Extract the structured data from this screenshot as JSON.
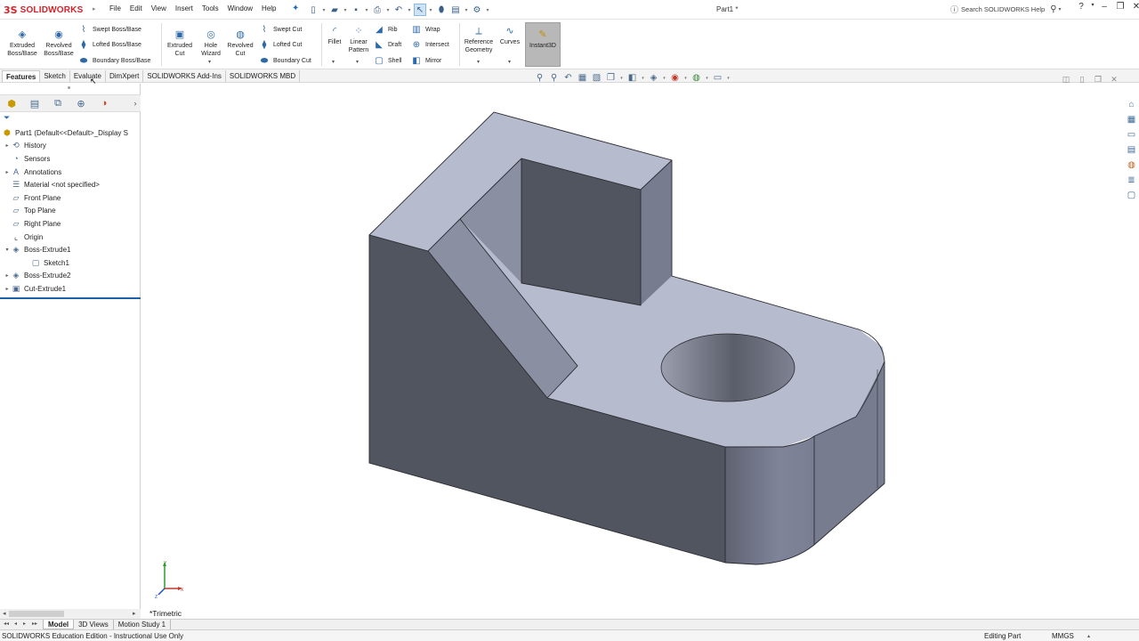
{
  "app": {
    "brand_prefix": "3S",
    "brand_name": "SOLIDWORKS",
    "document_title": "Part1 *",
    "help_search_placeholder": "Search SOLIDWORKS Help"
  },
  "menu": [
    "File",
    "Edit",
    "View",
    "Insert",
    "Tools",
    "Window",
    "Help"
  ],
  "command_manager": {
    "extruded_boss": "Extruded Boss/Base",
    "revolved_boss": "Revolved Boss/Base",
    "swept_boss": "Swept Boss/Base",
    "lofted_boss": "Lofted Boss/Base",
    "boundary_boss": "Boundary Boss/Base",
    "extruded_cut": "Extruded Cut",
    "hole_wizard": "Hole Wizard",
    "revolved_cut": "Revolved Cut",
    "swept_cut": "Swept Cut",
    "lofted_cut": "Lofted Cut",
    "boundary_cut": "Boundary Cut",
    "fillet": "Fillet",
    "linear_pattern": "Linear Pattern",
    "rib": "Rib",
    "draft": "Draft",
    "shell": "Shell",
    "wrap": "Wrap",
    "intersect": "Intersect",
    "mirror": "Mirror",
    "reference_geometry": "Reference Geometry",
    "curves": "Curves",
    "instant3d": "Instant3D"
  },
  "tabs": [
    "Features",
    "Sketch",
    "Evaluate",
    "DimXpert",
    "SOLIDWORKS Add-Ins",
    "SOLIDWORKS MBD"
  ],
  "active_tab": "Features",
  "feature_tree": [
    {
      "label": "Part1  (Default<<Default>_Display S",
      "level": 0,
      "toggle": "",
      "icon": "part"
    },
    {
      "label": "History",
      "level": 1,
      "toggle": "▸",
      "icon": "history"
    },
    {
      "label": "Sensors",
      "level": 1,
      "toggle": "",
      "icon": "sensor"
    },
    {
      "label": "Annotations",
      "level": 1,
      "toggle": "▸",
      "icon": "annotation"
    },
    {
      "label": "Material <not specified>",
      "level": 1,
      "toggle": "",
      "icon": "material"
    },
    {
      "label": "Front Plane",
      "level": 1,
      "toggle": "",
      "icon": "plane"
    },
    {
      "label": "Top Plane",
      "level": 1,
      "toggle": "",
      "icon": "plane"
    },
    {
      "label": "Right Plane",
      "level": 1,
      "toggle": "",
      "icon": "plane"
    },
    {
      "label": "Origin",
      "level": 1,
      "toggle": "",
      "icon": "origin"
    },
    {
      "label": "Boss-Extrude1",
      "level": 1,
      "toggle": "▾",
      "icon": "extrude"
    },
    {
      "label": "Sketch1",
      "level": 2,
      "toggle": "",
      "icon": "sketch"
    },
    {
      "label": "Boss-Extrude2",
      "level": 1,
      "toggle": "▸",
      "icon": "extrude"
    },
    {
      "label": "Cut-Extrude1",
      "level": 1,
      "toggle": "▸",
      "icon": "cut"
    }
  ],
  "viewport": {
    "view_name": "*Trimetric",
    "colors": {
      "top_face": "#b7bbce",
      "dark_face": "#515560",
      "mid_face": "#8b8fa2",
      "light_side": "#787c8f"
    }
  },
  "triad": {
    "x_label": "X",
    "y_label": "Y",
    "z_label": "Z"
  },
  "bottom_tabs": [
    "Model",
    "3D Views",
    "Motion Study 1"
  ],
  "active_bottom_tab": "Model",
  "status": {
    "edition": "SOLIDWORKS Education Edition - Instructional Use Only",
    "mode": "Editing Part",
    "units": "MMGS"
  }
}
